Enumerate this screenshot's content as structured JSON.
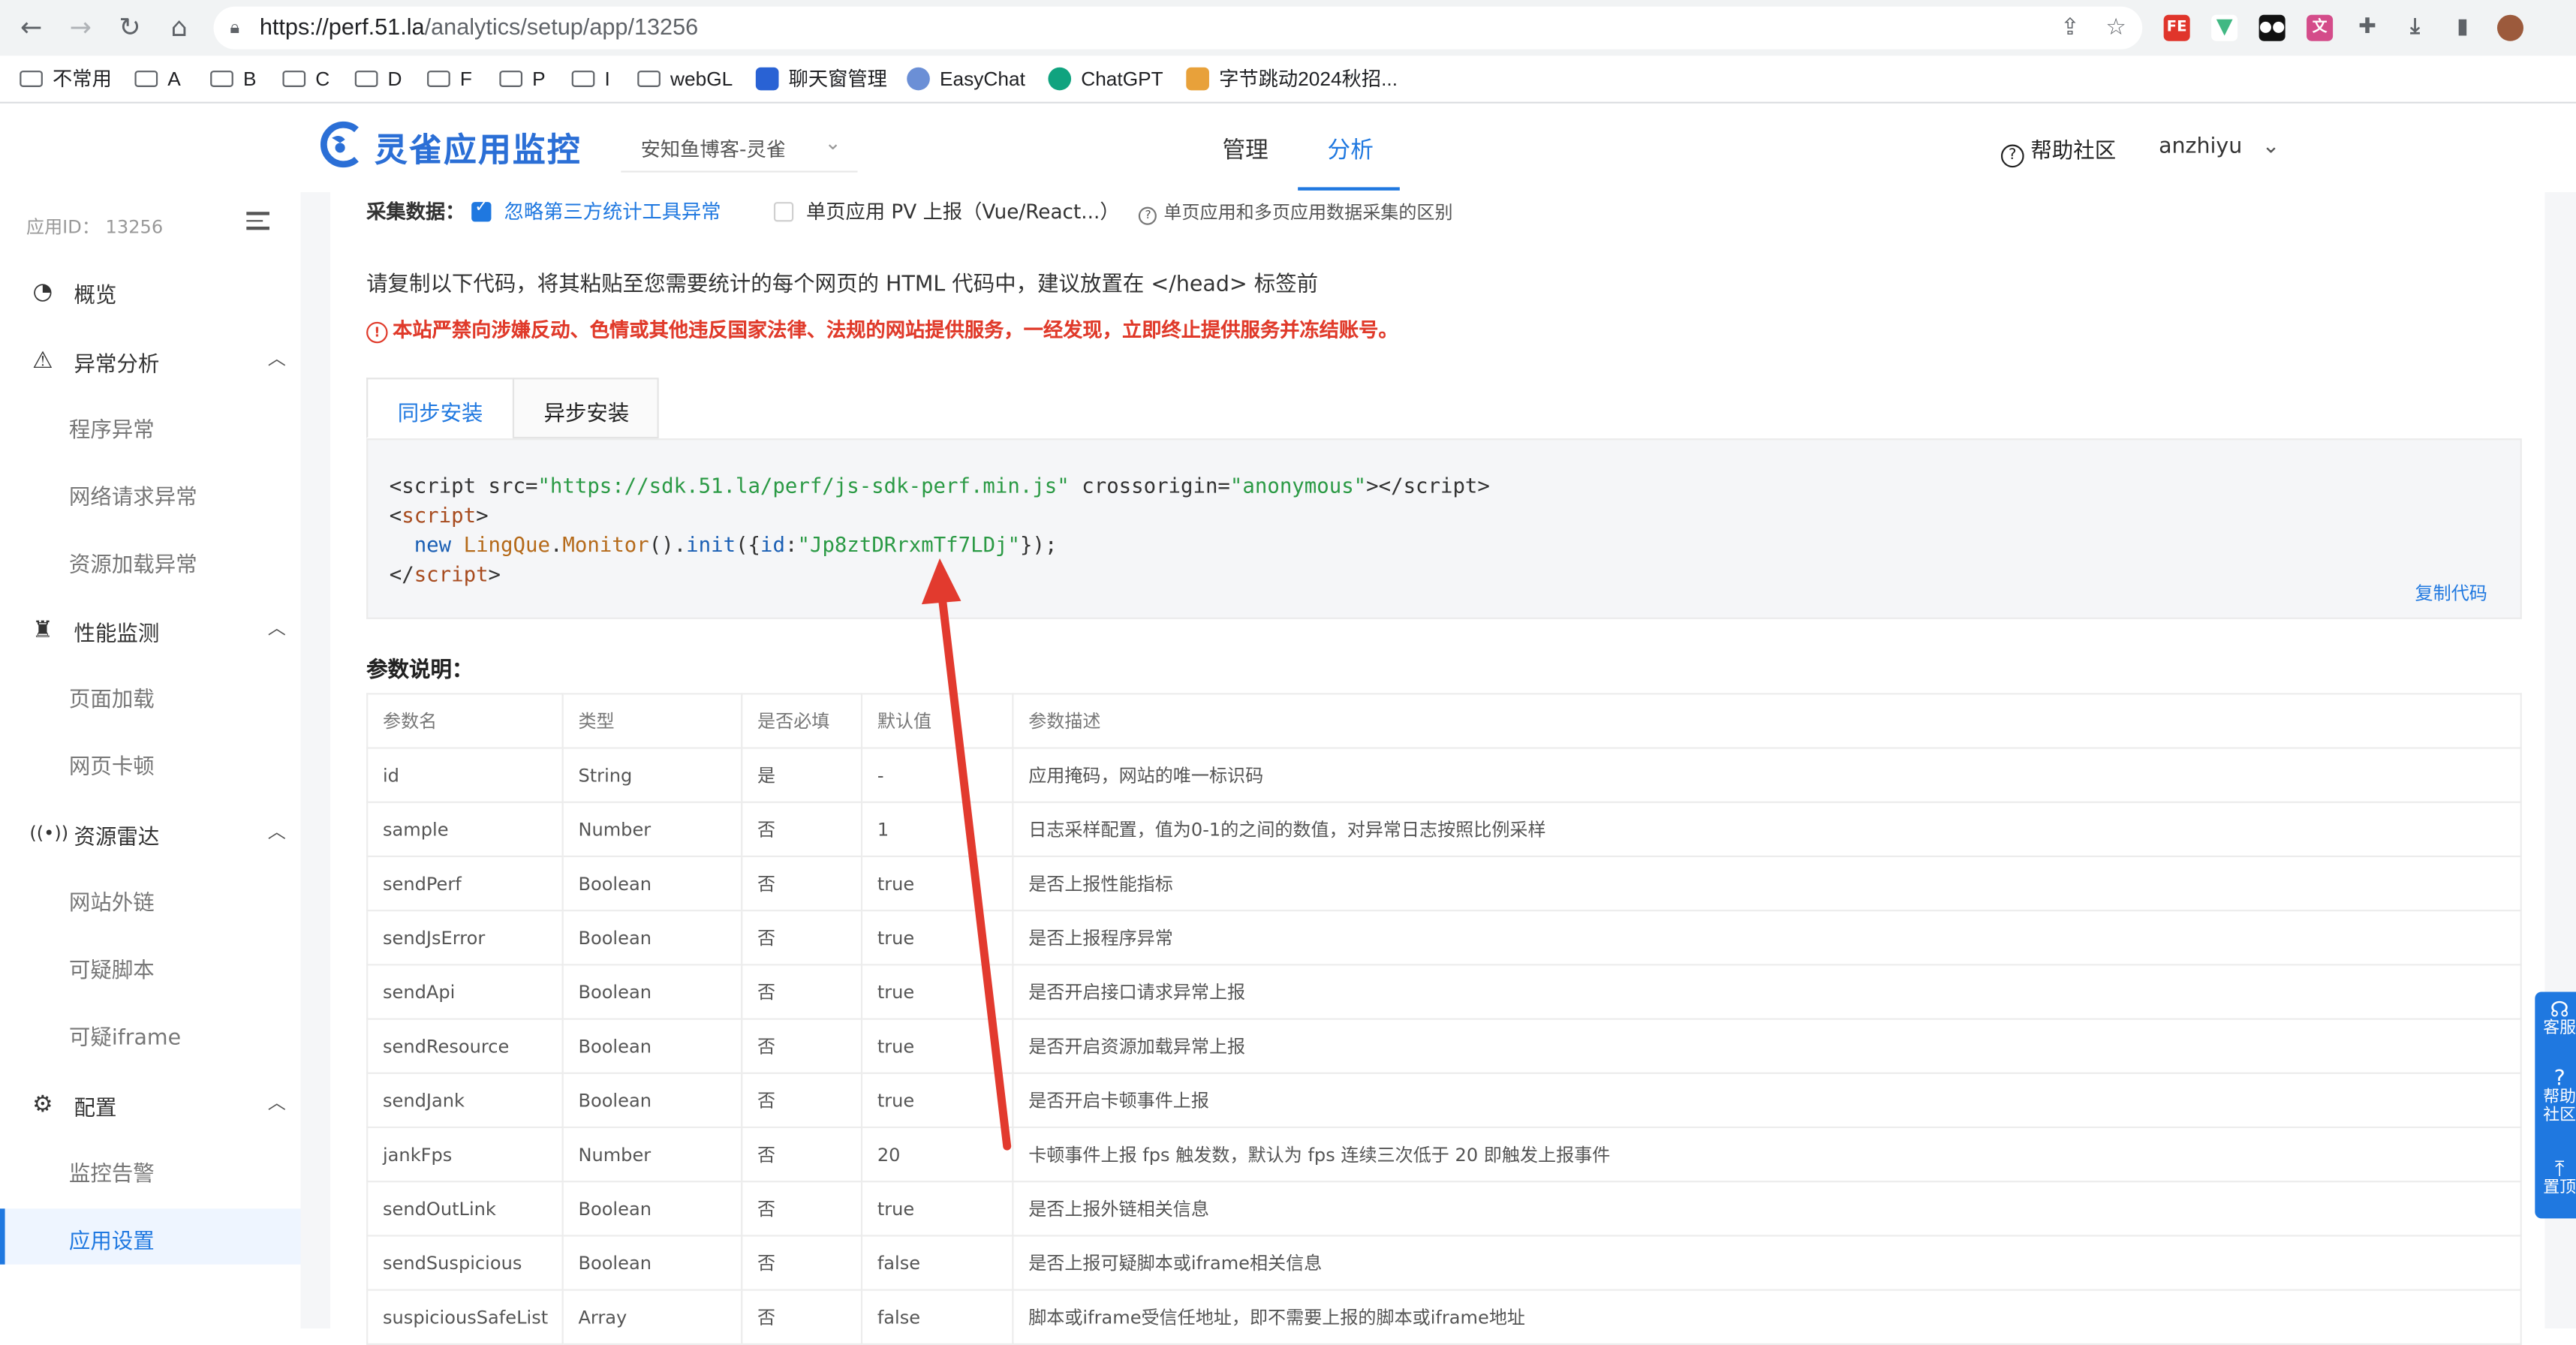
{
  "browser": {
    "url_host": "https://perf.51.la",
    "url_path": "/analytics/setup/app/13256",
    "bookmarks": [
      {
        "label": "不常用",
        "type": "folder"
      },
      {
        "label": "A",
        "type": "folder"
      },
      {
        "label": "B",
        "type": "folder"
      },
      {
        "label": "C",
        "type": "folder"
      },
      {
        "label": "D",
        "type": "folder"
      },
      {
        "label": "F",
        "type": "folder"
      },
      {
        "label": "P",
        "type": "folder"
      },
      {
        "label": "I",
        "type": "folder"
      },
      {
        "label": "webGL",
        "type": "folder"
      },
      {
        "label": "聊天窗管理",
        "type": "site"
      },
      {
        "label": "EasyChat",
        "type": "site"
      },
      {
        "label": "ChatGPT",
        "type": "site"
      },
      {
        "label": "字节跳动2024秋招...",
        "type": "site"
      }
    ]
  },
  "header": {
    "logo_text": "灵雀应用监控",
    "app_select": "安知鱼博客-灵雀",
    "tabs": [
      "管理",
      "分析"
    ],
    "active_tab": "分析",
    "help": "帮助社区",
    "user": "anzhiyu"
  },
  "sidebar": {
    "app_id_label": "应用ID：",
    "app_id": "13256",
    "overview": "概览",
    "groups": [
      {
        "label": "异常分析",
        "icon": "warning-icon",
        "items": [
          "程序异常",
          "网络请求异常",
          "资源加载异常"
        ]
      },
      {
        "label": "性能监测",
        "icon": "alarm-icon",
        "items": [
          "页面加载",
          "网页卡顿"
        ]
      },
      {
        "label": "资源雷达",
        "icon": "radar-icon",
        "items": [
          "网站外链",
          "可疑脚本",
          "可疑iframe"
        ]
      },
      {
        "label": "配置",
        "icon": "gear-icon",
        "items": [
          "监控告警",
          "应用设置"
        ]
      }
    ],
    "active_item": "应用设置"
  },
  "main": {
    "collect_label": "采集数据：",
    "opt_ignore": "忽略第三方统计工具异常",
    "opt_ignore_checked": true,
    "opt_spa": "单页应用 PV 上报（Vue/React...）",
    "opt_spa_checked": false,
    "spa_help": "单页应用和多页应用数据采集的区别",
    "instruction": "请复制以下代码，将其粘贴至您需要统计的每个网页的 HTML 代码中，建议放置在 </head> 标签前",
    "warning": "本站严禁向涉嫌反动、色情或其他违反国家法律、法规的网站提供服务，一经发现，立即终止提供服务并冻结账号。",
    "install_tabs": [
      "同步安装",
      "异步安装"
    ],
    "active_install_tab": "同步安装",
    "code": {
      "src": "https://sdk.51.la/perf/js-sdk-perf.min.js",
      "crossorigin": "anonymous",
      "obj": "LingQue",
      "cls": "Monitor",
      "method": "init",
      "id_key": "id",
      "id_value": "Jp8ztDRrxmTf7LDj"
    },
    "copy_code": "复制代码",
    "params_title": "参数说明：",
    "table_headers": [
      "参数名",
      "类型",
      "是否必填",
      "默认值",
      "参数描述"
    ],
    "table_rows": [
      [
        "id",
        "String",
        "是",
        "-",
        "应用掩码，网站的唯一标识码"
      ],
      [
        "sample",
        "Number",
        "否",
        "1",
        "日志采样配置，值为0-1的之间的数值，对异常日志按照比例采样"
      ],
      [
        "sendPerf",
        "Boolean",
        "否",
        "true",
        "是否上报性能指标"
      ],
      [
        "sendJsError",
        "Boolean",
        "否",
        "true",
        "是否上报程序异常"
      ],
      [
        "sendApi",
        "Boolean",
        "否",
        "true",
        "是否开启接口请求异常上报"
      ],
      [
        "sendResource",
        "Boolean",
        "否",
        "true",
        "是否开启资源加载异常上报"
      ],
      [
        "sendJank",
        "Boolean",
        "否",
        "true",
        "是否开启卡顿事件上报"
      ],
      [
        "jankFps",
        "Number",
        "否",
        "20",
        "卡顿事件上报 fps 触发数，默认为 fps 连续三次低于 20 即触发上报事件"
      ],
      [
        "sendOutLink",
        "Boolean",
        "否",
        "true",
        "是否上报外链相关信息"
      ],
      [
        "sendSuspicious",
        "Boolean",
        "否",
        "false",
        "是否上报可疑脚本或iframe相关信息"
      ],
      [
        "suspiciousSafeList",
        "Array",
        "否",
        "false",
        "脚本或iframe受信任地址，即不需要上报的脚本或iframe地址"
      ]
    ]
  },
  "floating": {
    "service": "客服",
    "help_line1": "帮助",
    "help_line2": "社区",
    "top": "置顶"
  },
  "colors": {
    "accent": "#1f78e0",
    "warning": "#e03a2a",
    "annotation_arrow": "#e23a2e"
  }
}
